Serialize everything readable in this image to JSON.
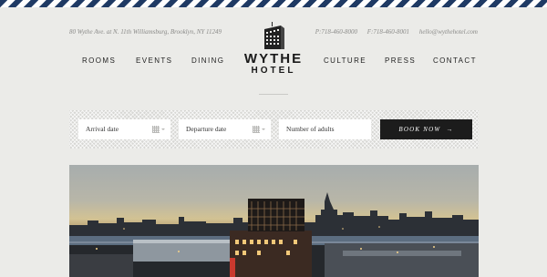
{
  "topbar": {
    "address": "80 Wythe Ave. at N. 11th Williamsburg, Brooklyn, NY 11249",
    "phone": "P:718-460-8000",
    "fax": "F:718-460-8001",
    "email": "hello@wythehotel.com"
  },
  "logo": {
    "title": "WYTHE",
    "subtitle": "HOTEL"
  },
  "nav": {
    "left": [
      "ROOMS",
      "EVENTS",
      "DINING"
    ],
    "right": [
      "CULTURE",
      "PRESS",
      "CONTACT"
    ]
  },
  "booking": {
    "arrival_placeholder": "Arrival date",
    "departure_placeholder": "Departure date",
    "adults_placeholder": "Number of adults",
    "button_label": "BOOK NOW",
    "button_arrow": "→"
  },
  "colors": {
    "stripe": "#1f3a64",
    "button": "#1c1c1c",
    "background": "#ebebe8"
  }
}
